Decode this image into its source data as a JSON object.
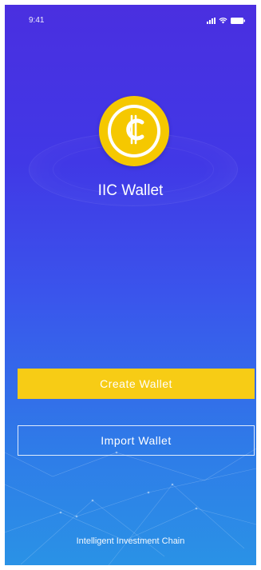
{
  "status_bar": {
    "time": "9:41",
    "icons": [
      "signal-icon",
      "wifi-icon",
      "battery-icon"
    ]
  },
  "app": {
    "logo_icon": "cedi-coin-icon",
    "title": "IIC Wallet",
    "tagline": "Intelligent Investment Chain"
  },
  "actions": {
    "create_label": "Create Wallet",
    "import_label": "Import Wallet"
  },
  "colors": {
    "accent": "#f7cc15",
    "background_top": "#4a2fe0",
    "background_bottom": "#2a92e6",
    "text": "#ffffff"
  }
}
